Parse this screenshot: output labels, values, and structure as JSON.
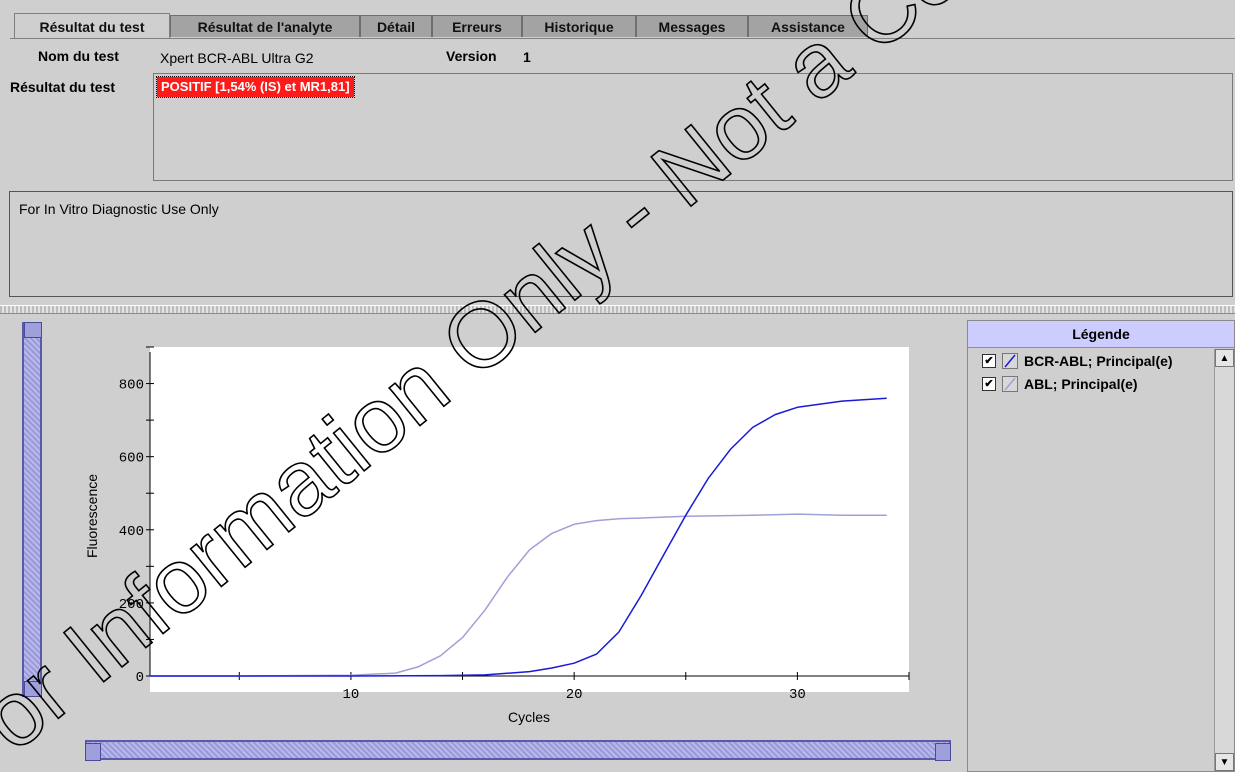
{
  "tabs": [
    {
      "label": "Résultat du test",
      "active": true
    },
    {
      "label": "Résultat de l'analyte"
    },
    {
      "label": "Détail"
    },
    {
      "label": "Erreurs"
    },
    {
      "label": "Historique"
    },
    {
      "label": "Messages"
    },
    {
      "label": "Assistance"
    }
  ],
  "info": {
    "test_name_label": "Nom du test",
    "test_name_value": "Xpert BCR-ABL Ultra G2",
    "version_label": "Version",
    "version_value": "1",
    "result_label": "Résultat du test",
    "result_value": "POSITIF [1,54% (IS) et MR1,81]",
    "result_color": "#ff1a1a"
  },
  "note": "For In Vitro Diagnostic Use Only",
  "watermark": "For Information Only - Not a Controlled Copy",
  "legend": {
    "title": "Légende",
    "items": [
      {
        "label": "BCR-ABL; Principal(e)",
        "color": "#1a1ad6",
        "checked": true
      },
      {
        "label": "ABL; Principal(e)",
        "color": "#a0a0d8",
        "checked": true
      }
    ]
  },
  "chart_data": {
    "type": "line",
    "xlabel": "Cycles",
    "ylabel": "Fluorescence",
    "xlim": [
      1,
      35
    ],
    "ylim": [
      0,
      900
    ],
    "xticks": [
      10,
      20,
      30
    ],
    "yticks": [
      0,
      200,
      400,
      600,
      800
    ],
    "grid": false,
    "series": [
      {
        "name": "BCR-ABL; Principal(e)",
        "color": "#1a1ad6",
        "x": [
          1,
          5,
          10,
          14,
          16,
          18,
          19,
          20,
          21,
          22,
          23,
          24,
          25,
          26,
          27,
          28,
          29,
          30,
          32,
          34
        ],
        "y": [
          0,
          0,
          0,
          1,
          3,
          12,
          22,
          35,
          60,
          120,
          220,
          330,
          440,
          540,
          620,
          680,
          715,
          735,
          752,
          760
        ]
      },
      {
        "name": "ABL; Principal(e)",
        "color": "#a0a0d8",
        "x": [
          1,
          5,
          10,
          12,
          13,
          14,
          15,
          16,
          17,
          18,
          19,
          20,
          21,
          22,
          25,
          28,
          30,
          32,
          34
        ],
        "y": [
          0,
          0,
          2,
          8,
          25,
          55,
          105,
          180,
          270,
          345,
          390,
          415,
          425,
          430,
          437,
          440,
          443,
          440,
          440
        ]
      }
    ]
  }
}
